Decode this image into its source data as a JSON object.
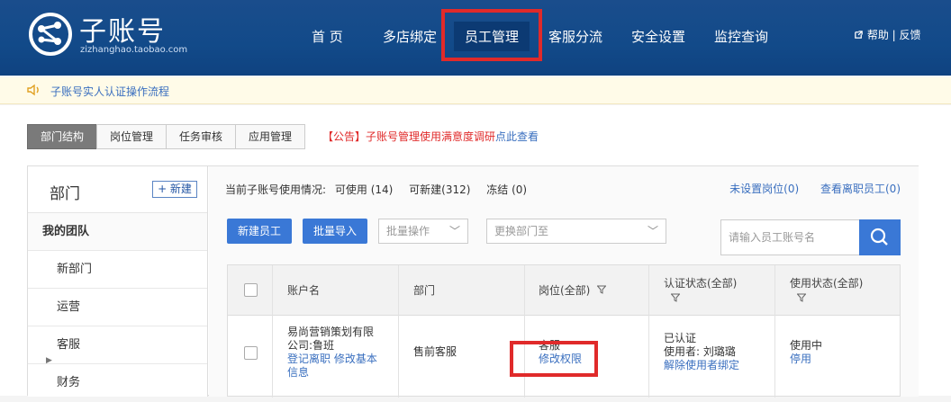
{
  "header": {
    "brand": "子账号",
    "brand_sub": "zizhanghao.taobao.com",
    "nav": [
      "首 页",
      "多店绑定",
      "员工管理",
      "客服分流",
      "安全设置",
      "监控查询"
    ],
    "help": "帮助 | 反馈"
  },
  "notice": {
    "text": "子账号实人认证操作流程"
  },
  "tabs": [
    "部门结构",
    "岗位管理",
    "任务审核",
    "应用管理"
  ],
  "announcement": {
    "prefix": "【公告】子账号管理使用满意度调研",
    "link": "点此查看"
  },
  "sidebar": {
    "title": "部门",
    "new_button": "+ 新建",
    "team": "我的团队",
    "items": [
      "新部门",
      "运营",
      "客服",
      "财务"
    ]
  },
  "usage": {
    "label": "当前子账号使用情况:",
    "used": "可使用 (14)",
    "creatable": "可新建(312)",
    "frozen": "冻结 (0)"
  },
  "top_links": {
    "unassigned": "未设置岗位(0)",
    "resigned": "查看离职员工(0)"
  },
  "actions": {
    "new_employee": "新建员工",
    "batch_import": "批量导入",
    "batch_ops": "批量操作",
    "change_dept": "更换部门至",
    "search_placeholder": "请输入员工账号名"
  },
  "table": {
    "headers": {
      "account": "账户名",
      "dept": "部门",
      "position": "岗位(全部)",
      "cert": "认证状态(全部)",
      "status": "使用状态(全部)"
    },
    "rows": [
      {
        "account_line1": "易尚营销策划有限",
        "account_line2": "公司:鲁班",
        "action_resign": "登记离职",
        "action_edit_1": "修改基本",
        "action_edit_2": "信息",
        "dept": "售前客服",
        "position": "客服",
        "position_action": "修改权限",
        "cert": "已认证",
        "cert_user": "使用者: 刘璐璐",
        "cert_action": "解除使用者绑定",
        "status": "使用中",
        "status_action": "停用"
      }
    ]
  }
}
